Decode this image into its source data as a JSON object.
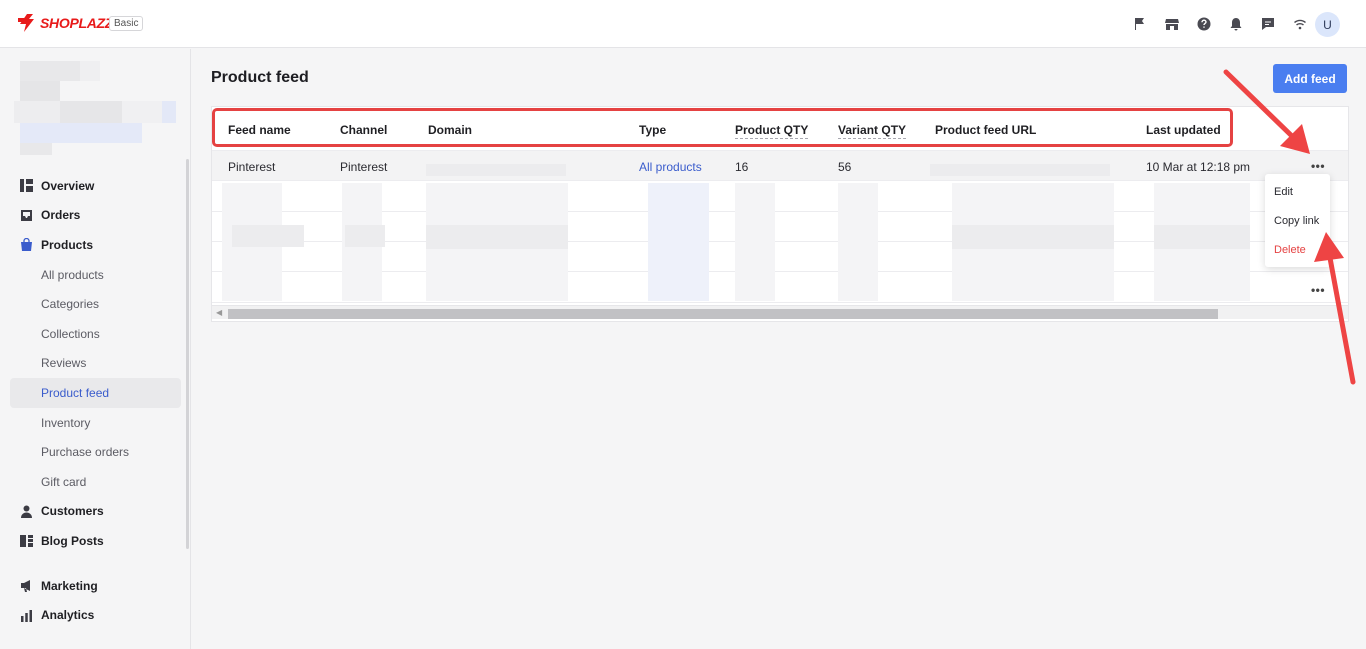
{
  "app": {
    "logo_text": "SHOPLAZZA",
    "plan_badge": "Basic",
    "avatar_initial": "U",
    "brand_color": "#e81a1a",
    "accent_color": "#4a7ef0"
  },
  "topbar": {
    "icons": [
      "flag-icon",
      "store-icon",
      "help-icon",
      "bell-icon",
      "chat-icon",
      "wifi-icon"
    ]
  },
  "sidebar": {
    "items": [
      {
        "label": "Overview",
        "icon": "overview-icon"
      },
      {
        "label": "Orders",
        "icon": "orders-icon"
      },
      {
        "label": "Products",
        "icon": "products-icon"
      },
      {
        "label": "All products"
      },
      {
        "label": "Categories"
      },
      {
        "label": "Collections"
      },
      {
        "label": "Reviews"
      },
      {
        "label": "Product feed",
        "active": true
      },
      {
        "label": "Inventory"
      },
      {
        "label": "Purchase orders"
      },
      {
        "label": "Gift card"
      },
      {
        "label": "Customers",
        "icon": "customers-icon"
      },
      {
        "label": "Blog Posts",
        "icon": "blog-icon"
      },
      {
        "label": "Marketing",
        "icon": "marketing-icon"
      },
      {
        "label": "Analytics",
        "icon": "analytics-icon"
      }
    ]
  },
  "main": {
    "title": "Product feed",
    "add_button": "Add feed"
  },
  "table": {
    "columns": [
      "Feed name",
      "Channel",
      "Domain",
      "Type",
      "Product QTY",
      "Variant QTY",
      "Product feed URL",
      "Last updated"
    ],
    "rows": [
      {
        "feed_name": "Pinterest",
        "channel": "Pinterest",
        "type": "All products",
        "product_qty": "16",
        "variant_qty": "56",
        "last_updated": "10 Mar at 12:18 pm"
      }
    ],
    "more_label": "•••"
  },
  "row_menu": {
    "edit": "Edit",
    "copy_link": "Copy link",
    "delete": "Delete"
  }
}
